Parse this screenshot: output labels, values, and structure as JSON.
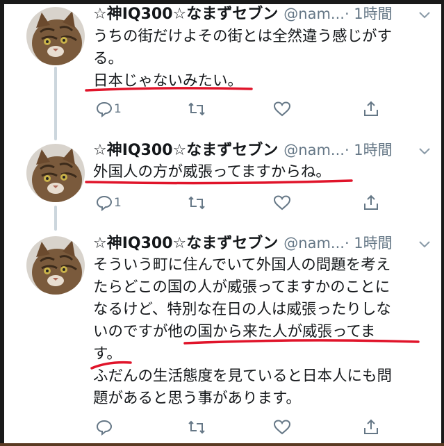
{
  "tweets": [
    {
      "name": "☆神IQ300☆なまずセブン",
      "handle": "@nam...",
      "time": "· 1時間",
      "lines": [
        "うちの街だけよその街とは全然違う感じがす",
        "る。",
        "日本じゃないみたい。"
      ],
      "reply_count": "1",
      "retweet_count": "",
      "like_count": ""
    },
    {
      "name": "☆神IQ300☆なまずセブン",
      "handle": "@nam...",
      "time": "· 1時間",
      "lines": [
        "外国人の方が威張ってますからね。"
      ],
      "reply_count": "1",
      "retweet_count": "",
      "like_count": ""
    },
    {
      "name": "☆神IQ300☆なまずセブン",
      "handle": "@nam...",
      "time": "· 1時間",
      "lines": [
        "そういう町に住んでいて外国人の問題を考え",
        "たらどこの国の人が威張ってますかのことに",
        "なるけど、特別な在日の人は威張ったりしな",
        "いのですが他の国から来た人が威張ってま",
        "す。",
        "ふだんの生活態度を見ていると日本人にも問",
        "題があると思う事があります。"
      ],
      "reply_count": "",
      "retweet_count": "",
      "like_count": ""
    }
  ],
  "icons": [
    "reply-icon",
    "retweet-icon",
    "like-icon",
    "share-icon",
    "chevron-down-icon"
  ],
  "colors": {
    "highlight_underline": "#e0142a",
    "thread_line": "#ccd6dd",
    "secondary_text": "#657786"
  }
}
